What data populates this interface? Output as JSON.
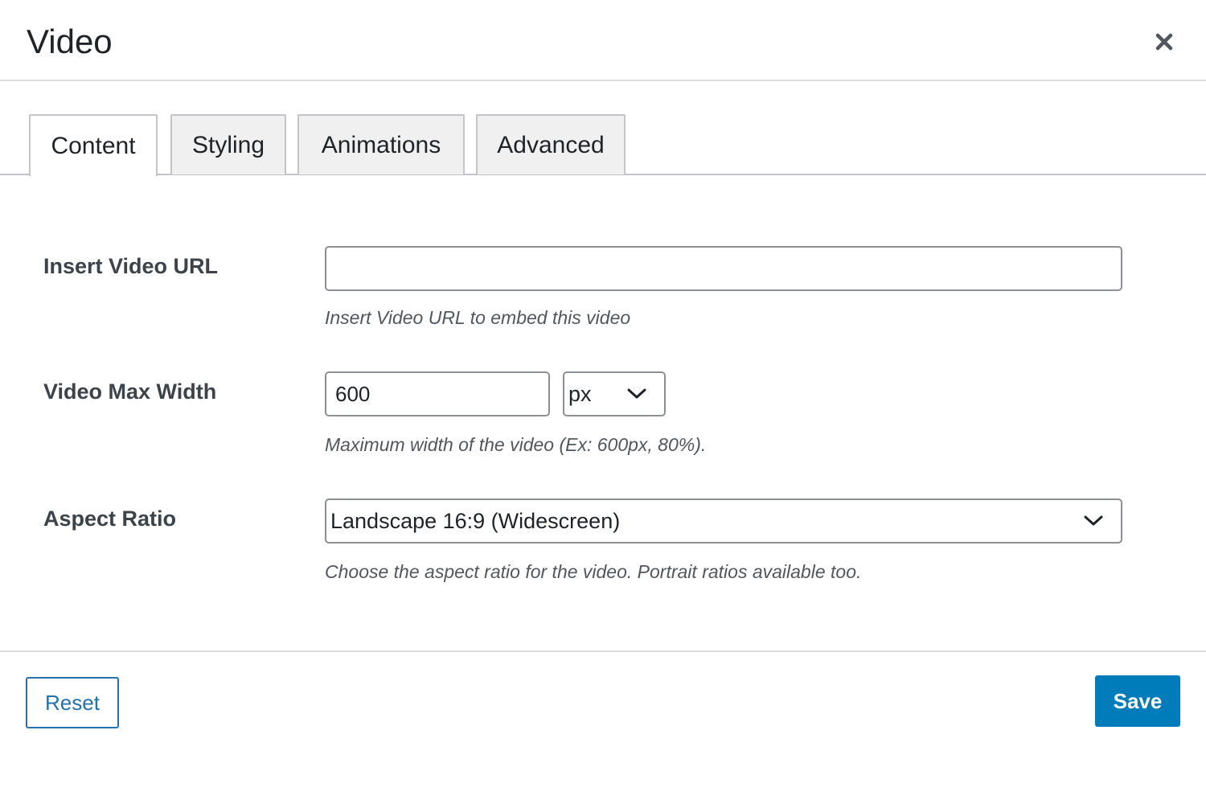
{
  "dialog": {
    "title": "Video",
    "close_icon": "close-icon"
  },
  "tabs": [
    {
      "label": "Content",
      "active": true
    },
    {
      "label": "Styling",
      "active": false
    },
    {
      "label": "Animations",
      "active": false
    },
    {
      "label": "Advanced",
      "active": false
    }
  ],
  "fields": {
    "video_url": {
      "label": "Insert Video URL",
      "value": "",
      "placeholder": "",
      "hint": "Insert Video URL to embed this video"
    },
    "max_width": {
      "label": "Video Max Width",
      "value": "600",
      "unit_selected": "px",
      "hint": "Maximum width of the video (Ex: 600px, 80%)."
    },
    "aspect_ratio": {
      "label": "Aspect Ratio",
      "selected": "Landscape 16:9 (Widescreen)",
      "hint": "Choose the aspect ratio for the video. Portrait ratios available too."
    }
  },
  "footer": {
    "reset_label": "Reset",
    "save_label": "Save"
  },
  "colors": {
    "accent": "#007cba",
    "reset_text": "#2271b1"
  }
}
